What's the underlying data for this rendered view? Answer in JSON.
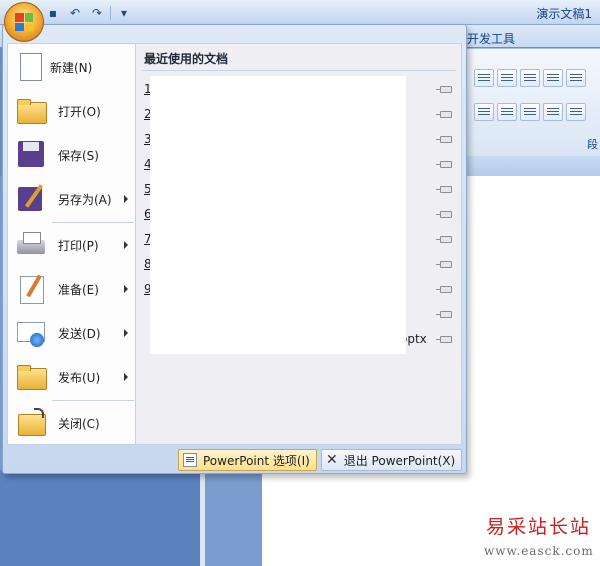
{
  "window": {
    "title": "演示文稿1"
  },
  "ribbon": {
    "tab_label": "开发工具",
    "group_label": "段"
  },
  "office_menu": {
    "items": [
      {
        "label": "新建(N)",
        "icon": "new-document-icon",
        "submenu": false
      },
      {
        "label": "打开(O)",
        "icon": "open-folder-icon",
        "submenu": false
      },
      {
        "label": "保存(S)",
        "icon": "save-icon",
        "submenu": false
      },
      {
        "label": "另存为(A)",
        "icon": "save-as-icon",
        "submenu": true
      },
      {
        "label": "打印(P)",
        "icon": "print-icon",
        "submenu": true
      },
      {
        "label": "准备(E)",
        "icon": "prepare-icon",
        "submenu": true
      },
      {
        "label": "发送(D)",
        "icon": "send-icon",
        "submenu": true
      },
      {
        "label": "发布(U)",
        "icon": "publish-icon",
        "submenu": true
      },
      {
        "label": "关闭(C)",
        "icon": "close-folder-icon",
        "submenu": false
      }
    ],
    "recent": {
      "title": "最近使用的文档",
      "numbers": [
        "1",
        "2",
        "3",
        "4",
        "5",
        "6",
        "7",
        "8",
        "9"
      ],
      "partial_name": "optx"
    },
    "footer": {
      "options_label": "PowerPoint 选项(I)",
      "exit_label": "退出 PowerPoint(X)"
    }
  },
  "watermark": {
    "title": "易采站长站",
    "url": "www.easck.com"
  }
}
